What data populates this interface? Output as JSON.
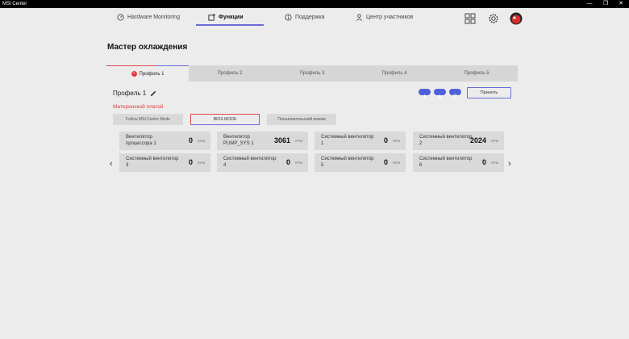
{
  "window": {
    "title": "MSI Center",
    "minimize": "—",
    "maximize": "❐",
    "close": "✕"
  },
  "nav": {
    "tabs": [
      {
        "label": "Hardware Monitoring",
        "icon": "gauge-icon"
      },
      {
        "label": "Функции",
        "icon": "plus-window-icon",
        "active": true
      },
      {
        "label": "Поддержка",
        "icon": "info-icon"
      },
      {
        "label": "Центр участников",
        "icon": "user-icon"
      }
    ],
    "right_icons": [
      "grid-icon",
      "gear-icon",
      "avatar-icon"
    ],
    "accent_color": "#6a6ad8"
  },
  "page": {
    "title": "Мастер охлаждения"
  },
  "profiles": {
    "tabs": [
      "Профиль 1",
      "Профиль 2",
      "Профиль 3",
      "Профиль 4",
      "Профиль 5"
    ],
    "active_index": 0
  },
  "panel": {
    "profile_name": "Профиль 1",
    "apply_label": "Принять",
    "source_label": "Материнской платой",
    "modes": [
      "Follow MSI Center Mode",
      "BIOS MODE",
      "Пользовательский режим"
    ],
    "active_mode_index": 1,
    "fans": [
      {
        "name": "Вентилятор процессора 1",
        "value": "0",
        "unit": "RPM"
      },
      {
        "name": "Вентилятор PUMP_SYS 1",
        "value": "3061",
        "unit": "RPM"
      },
      {
        "name": "Системный вентилятор 1",
        "value": "0",
        "unit": "RPM"
      },
      {
        "name": "Системный вентилятор 2",
        "value": "2024",
        "unit": "RPM"
      },
      {
        "name": "Системный вентилятор 3",
        "value": "0",
        "unit": "RPM"
      },
      {
        "name": "Системный вентилятор 4",
        "value": "0",
        "unit": "RPM"
      },
      {
        "name": "Системный вентилятор 5",
        "value": "0",
        "unit": "RPM"
      },
      {
        "name": "Системный вентилятор 6",
        "value": "0",
        "unit": "RPM"
      }
    ],
    "prev_arrow": "‹",
    "next_arrow": "›"
  },
  "colors": {
    "accent": "#6a6ad8",
    "highlight": "#e0393e"
  }
}
